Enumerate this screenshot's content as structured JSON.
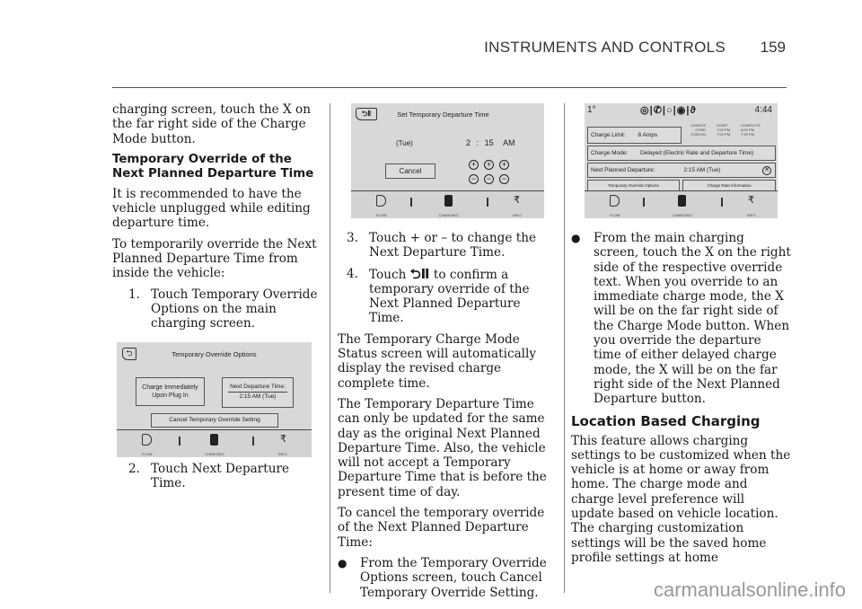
{
  "header": {
    "section_title": "INSTRUMENTS AND CONTROLS",
    "page_number": "159"
  },
  "col1": {
    "intro": "charging screen, touch the X on the far right side of the Charge Mode button.",
    "heading": "Temporary Override of the Next Planned Departure Time",
    "para1": "It is recommended to have the vehicle unplugged while editing departure time.",
    "para2": "To temporarily override the Next Planned Departure Time from inside the vehicle:",
    "step1_num": "1.",
    "step1": "Touch Temporary Override Options on the main charging screen.",
    "step2_num": "2.",
    "step2": "Touch Next Departure Time."
  },
  "screen1": {
    "title": "Temporary Override Options",
    "btn_charge_now": "Charge Immediately Upon Plug In",
    "btn_next_dep_label": "Next Departure Time:",
    "btn_next_dep_value": "2:15 AM (Tue)",
    "btn_cancel": "Cancel Temporary Override Setting",
    "nav": {
      "flow": "FLOW",
      "charging": "CHARGING",
      "info": "INFO"
    }
  },
  "screen2": {
    "title": "Set Temporary Departure Time",
    "day": "(Tue)",
    "hour": "2",
    "colon": ":",
    "minute": "15",
    "ampm": "AM",
    "cancel": "Cancel",
    "plus": "+",
    "minus": "−",
    "nav": {
      "flow": "FLOW",
      "charging": "CHARGING",
      "info": "INFO"
    }
  },
  "col2": {
    "step3_num": "3.",
    "step3": "Touch + or – to change the Next Departure Time.",
    "step4_num": "4.",
    "step4_pre": "Touch",
    "step4_post": "to confirm a temporary override of the Next Planned Departure Time.",
    "para1": "The Temporary Charge Mode Status screen will automatically display the revised charge complete time.",
    "para2": "The Temporary Departure Time can only be updated for the same day as the original Next Planned Departure Time. Also, the vehicle will not accept a Temporary Departure Time that is before the present time of day.",
    "para3": "To cancel the temporary override of the Next Planned Departure Time:",
    "bullet1": "From the Temporary Override Options screen, touch Cancel Temporary Override Setting."
  },
  "screen3": {
    "temp": "1°",
    "clock": "4:44",
    "charge_limit_label": "Charge Limit:",
    "charge_limit_value": "8 Amps",
    "table": {
      "headers": [
        "CHARGE",
        "START",
        "COMPLETE"
      ],
      "rows": [
        [
          "CORD",
          "7:00 PM",
          "6:00 PM"
        ],
        [
          "STATION",
          "7:00 PM",
          "7:30 PM"
        ]
      ]
    },
    "charge_mode_label": "Charge Mode:",
    "charge_mode_value": "Delayed (Electric Rate and Departure Time)",
    "next_dep_label": "Next Planned Departure:",
    "next_dep_value": "2:15 AM (Tue)",
    "btn_override": "Temporary Override Options",
    "btn_rate": "Charge Rate Information",
    "nav": {
      "flow": "FLOW",
      "charging": "CHARGING",
      "info": "INFO"
    }
  },
  "col3": {
    "bullet1": "From the main charging screen, touch the X on the right side of the respective override text. When you override to an immediate charge mode, the X will be on the far right side of the Charge Mode button. When you override the departure time of either delayed charge mode, the X will be on the far right side of the Next Planned Departure button.",
    "heading": "Location Based Charging",
    "para1": "This feature allows charging settings to be customized when the vehicle is at home or away from home. The charge mode and charge level preference will update based on vehicle location. The charging customization settings will be the saved home profile settings at home"
  },
  "watermark": "carmanualsonline.info"
}
